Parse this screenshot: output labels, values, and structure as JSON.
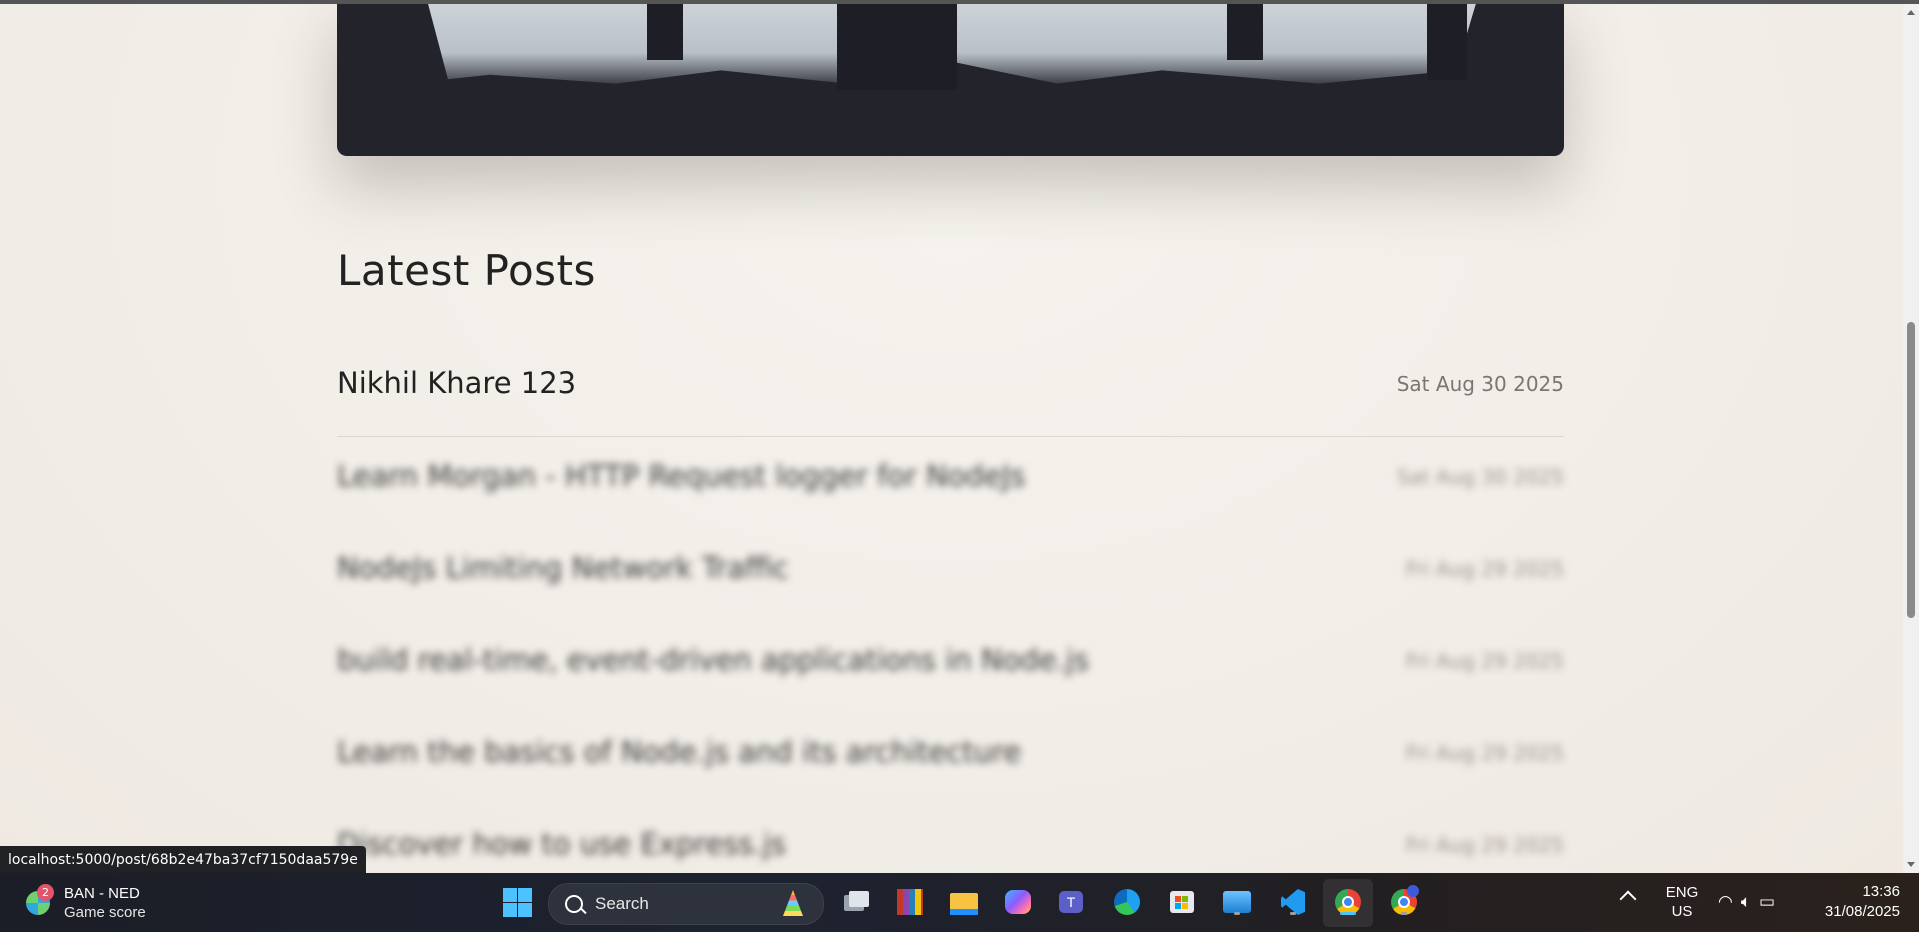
{
  "browser": {
    "status_url": "localhost:5000/post/68b2e47ba37cf7150daa579e"
  },
  "page": {
    "section_title": "Latest Posts",
    "posts": [
      {
        "title": "Nikhil Khare 123",
        "date": "Sat Aug 30 2025"
      },
      {
        "title": "Learn Morgan - HTTP Request logger for NodeJs",
        "date": "Sat Aug 30 2025"
      },
      {
        "title": "NodeJs Limiting Network Traffic",
        "date": "Fri Aug 29 2025"
      },
      {
        "title": "build real-time, event-driven applications in Node.js",
        "date": "Fri Aug 29 2025"
      },
      {
        "title": "Learn the basics of Node.js and its architecture",
        "date": "Fri Aug 29 2025"
      },
      {
        "title": "Discover how to use Express.js",
        "date": "Fri Aug 29 2025"
      }
    ]
  },
  "taskbar": {
    "widget": {
      "badge": "2",
      "line1": "BAN - NED",
      "line2": "Game score"
    },
    "search_label": "Search",
    "apps": [
      "task-view",
      "winrar",
      "file-explorer",
      "copilot",
      "teams",
      "edge",
      "microsoft-store",
      "photos",
      "vscode",
      "chrome",
      "chrome-profile"
    ],
    "language": {
      "line1": "ENG",
      "line2": "US"
    },
    "clock": {
      "time": "13:36",
      "date": "31/08/2025"
    }
  },
  "colors": {
    "page_bg": "#f3efe9",
    "hero_bg": "#23232b",
    "accent": "#4cc2ff"
  }
}
